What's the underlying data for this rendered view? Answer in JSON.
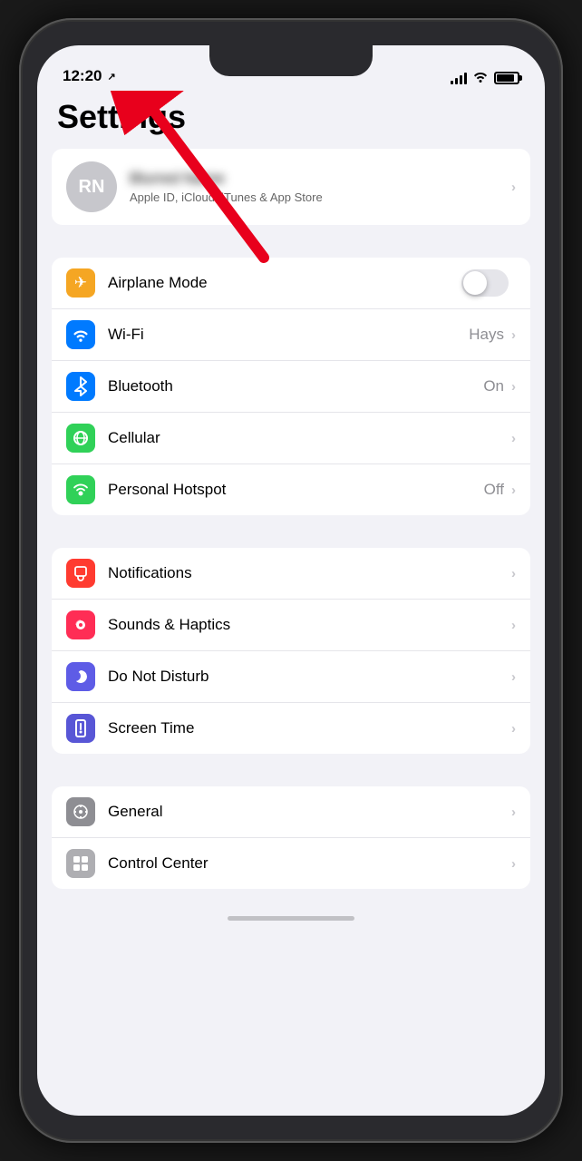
{
  "status_bar": {
    "time": "12:20",
    "has_location": true
  },
  "page": {
    "title": "Settings"
  },
  "apple_id": {
    "initials": "RN",
    "name": "Blurred Name",
    "subtitle": "Apple ID, iCloud, iTunes & App Store"
  },
  "connectivity_section": {
    "items": [
      {
        "id": "airplane-mode",
        "label": "Airplane Mode",
        "value": "",
        "toggle": true,
        "toggle_on": false,
        "icon_bg": "orange",
        "icon": "✈"
      },
      {
        "id": "wifi",
        "label": "Wi-Fi",
        "value": "Hays",
        "toggle": false,
        "icon_bg": "blue",
        "icon": "wifi"
      },
      {
        "id": "bluetooth",
        "label": "Bluetooth",
        "value": "On",
        "toggle": false,
        "icon_bg": "blue",
        "icon": "bluetooth"
      },
      {
        "id": "cellular",
        "label": "Cellular",
        "value": "",
        "toggle": false,
        "icon_bg": "green",
        "icon": "cellular"
      },
      {
        "id": "hotspot",
        "label": "Personal Hotspot",
        "value": "Off",
        "toggle": false,
        "icon_bg": "green",
        "icon": "hotspot"
      }
    ]
  },
  "alerts_section": {
    "items": [
      {
        "id": "notifications",
        "label": "Notifications",
        "value": "",
        "icon_bg": "red",
        "icon": "notif"
      },
      {
        "id": "sounds",
        "label": "Sounds & Haptics",
        "value": "",
        "icon_bg": "pink",
        "icon": "sound"
      },
      {
        "id": "dnd",
        "label": "Do Not Disturb",
        "value": "",
        "icon_bg": "indigo",
        "icon": "moon"
      },
      {
        "id": "screen-time",
        "label": "Screen Time",
        "value": "",
        "icon_bg": "purple",
        "icon": "hourglass"
      }
    ]
  },
  "general_section": {
    "items": [
      {
        "id": "general",
        "label": "General",
        "value": "",
        "icon_bg": "gray",
        "icon": "gear"
      },
      {
        "id": "control-center",
        "label": "Control Center",
        "value": "",
        "icon_bg": "gray2",
        "icon": "sliders"
      }
    ]
  }
}
